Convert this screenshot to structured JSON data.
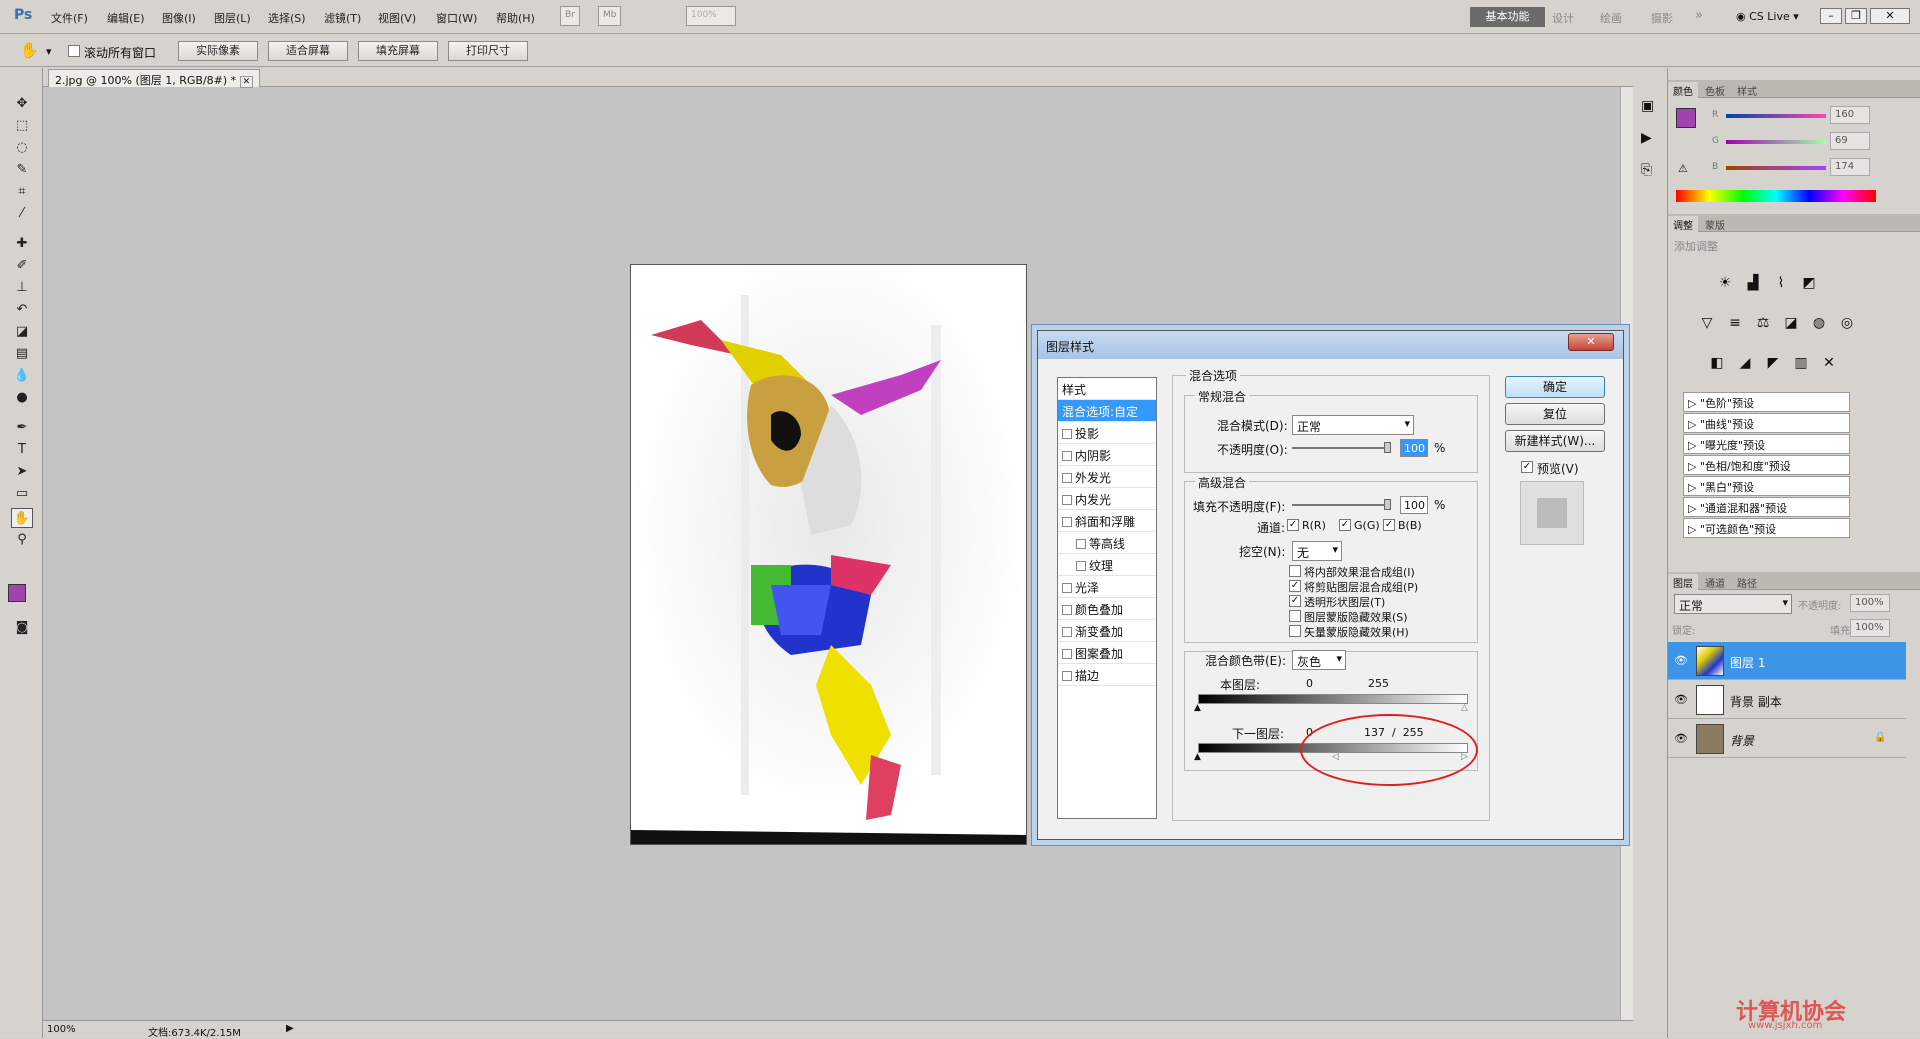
{
  "app": {
    "logo": "Ps"
  },
  "menu": [
    "文件(F)",
    "编辑(E)",
    "图像(I)",
    "图层(L)",
    "选择(S)",
    "滤镜(T)",
    "视图(V)",
    "窗口(W)",
    "帮助(H)"
  ],
  "menubar_misc": {
    "br": "Br",
    "mb": "Mb",
    "zoom": "100%"
  },
  "workspaces": [
    "基本功能",
    "设计",
    "绘画",
    "摄影"
  ],
  "cslive": "CS Live",
  "options": {
    "scroll_all": "滚动所有窗口",
    "buttons": [
      "实际像素",
      "适合屏幕",
      "填充屏幕",
      "打印尺寸"
    ]
  },
  "doc_tab": "2.jpg @ 100% (图层 1, RGB/8#) *",
  "status": {
    "zoom": "100%",
    "doc": "文档:673.4K/2.15M"
  },
  "dialog": {
    "title": "图层样式",
    "style_list": [
      "样式",
      "混合选项:自定",
      "投影",
      "内阴影",
      "外发光",
      "内发光",
      "斜面和浮雕",
      "等高线",
      "纹理",
      "光泽",
      "颜色叠加",
      "渐变叠加",
      "图案叠加",
      "描边"
    ],
    "blend_options": "混合选项",
    "general": "常规混合",
    "blend_mode_label": "混合模式(D):",
    "blend_mode": "正常",
    "opacity_label": "不透明度(O):",
    "opacity": "100",
    "percent": "%",
    "advanced": "高级混合",
    "fill_label": "填充不透明度(F):",
    "fill": "100",
    "channels_label": "通道:",
    "channels": [
      "R(R)",
      "G(G)",
      "B(B)"
    ],
    "knockout_label": "挖空(N):",
    "knockout": "无",
    "options": [
      "将内部效果混合成组(I)",
      "将剪贴图层混合成组(P)",
      "透明形状图层(T)",
      "图层蒙版隐藏效果(S)",
      "矢量蒙版隐藏效果(H)"
    ],
    "options_checked": [
      false,
      true,
      true,
      false,
      false
    ],
    "blend_if_label": "混合颜色带(E):",
    "blend_if": "灰色",
    "this_layer": "本图层:",
    "this_low": "0",
    "this_high": "255",
    "underlying": "下一图层:",
    "under_low": "0",
    "under_split": "137  /  255",
    "buttons": {
      "ok": "确定",
      "reset": "复位",
      "new_style": "新建样式(W)...",
      "preview": "预览(V)"
    }
  },
  "color_panel": {
    "tabs": [
      "颜色",
      "色板",
      "样式"
    ],
    "r_label": "R",
    "g_label": "G",
    "b_label": "B",
    "r": "160",
    "g": "69",
    "b": "174",
    "fg_color": "#a045ae"
  },
  "adjust_panel": {
    "tabs": [
      "调整",
      "蒙版"
    ],
    "add_label": "添加调整",
    "presets": [
      "\"色阶\"预设",
      "\"曲线\"预设",
      "\"曝光度\"预设",
      "\"色相/饱和度\"预设",
      "\"黑白\"预设",
      "\"通道混和器\"预设",
      "\"可选颜色\"预设"
    ]
  },
  "layers_panel": {
    "tabs": [
      "图层",
      "通道",
      "路径"
    ],
    "mode": "正常",
    "opacity_label": "不透明度:",
    "opacity": "100%",
    "lock_label": "锁定:",
    "fill_label": "填充:",
    "fill": "100%",
    "layers": [
      "图层 1",
      "背景 副本",
      "背景"
    ]
  },
  "watermark": {
    "text": "计算机协会",
    "url": "www.jsjxh.com"
  }
}
